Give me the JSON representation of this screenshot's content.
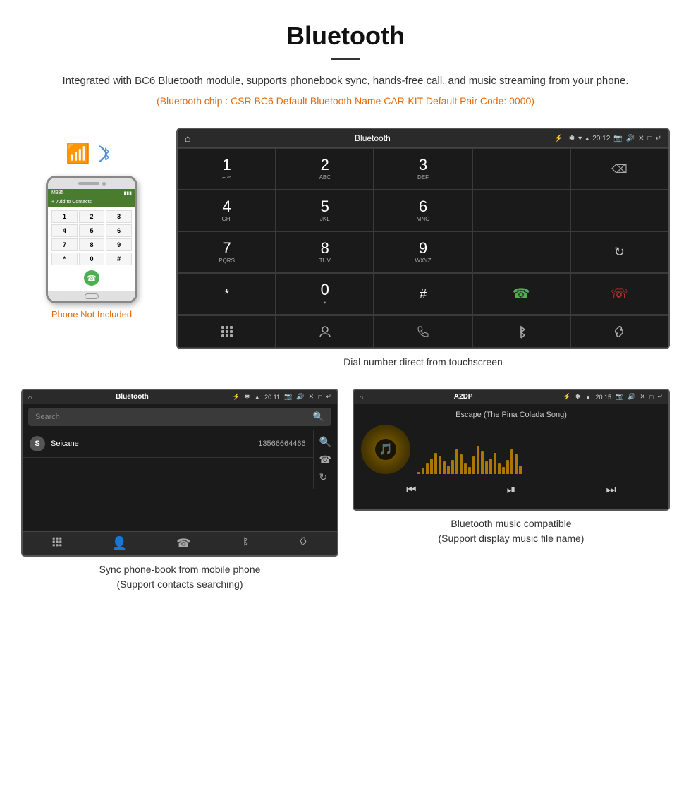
{
  "header": {
    "title": "Bluetooth",
    "description": "Integrated with BC6 Bluetooth module, supports phonebook sync, hands-free call, and music streaming from your phone.",
    "spec_line": "(Bluetooth chip : CSR BC6    Default Bluetooth Name CAR-KIT     Default Pair Code: 0000)"
  },
  "phone_label": "Phone Not Included",
  "dial_screen": {
    "title": "Bluetooth",
    "time": "20:12",
    "caption": "Dial number direct from touchscreen",
    "keys": [
      {
        "num": "1",
        "sub": "⌐"
      },
      {
        "num": "2",
        "sub": "ABC"
      },
      {
        "num": "3",
        "sub": "DEF"
      },
      {
        "num": "",
        "sub": ""
      },
      {
        "num": "⌫",
        "sub": ""
      },
      {
        "num": "4",
        "sub": "GHI"
      },
      {
        "num": "5",
        "sub": "JKL"
      },
      {
        "num": "6",
        "sub": "MNO"
      },
      {
        "num": "",
        "sub": ""
      },
      {
        "num": "",
        "sub": ""
      },
      {
        "num": "7",
        "sub": "PQRS"
      },
      {
        "num": "8",
        "sub": "TUV"
      },
      {
        "num": "9",
        "sub": "WXYZ"
      },
      {
        "num": "",
        "sub": ""
      },
      {
        "num": "↺",
        "sub": ""
      },
      {
        "num": "*",
        "sub": ""
      },
      {
        "num": "0",
        "sub": "+"
      },
      {
        "num": "#",
        "sub": ""
      },
      {
        "num": "📞",
        "sub": ""
      },
      {
        "num": "📞end",
        "sub": ""
      }
    ]
  },
  "phonebook_screen": {
    "title": "Bluetooth",
    "time": "20:11",
    "search_placeholder": "Search",
    "contact": {
      "initial": "S",
      "name": "Seicane",
      "number": "13566664466"
    },
    "caption_line1": "Sync phone-book from mobile phone",
    "caption_line2": "(Support contacts searching)"
  },
  "music_screen": {
    "title": "A2DP",
    "time": "20:15",
    "song_title": "Escape (The Pina Colada Song)",
    "caption_line1": "Bluetooth music compatible",
    "caption_line2": "(Support display music file name)"
  },
  "eq_bars": [
    3,
    8,
    15,
    22,
    30,
    25,
    18,
    12,
    20,
    35,
    28,
    15,
    10,
    25,
    40,
    32,
    18,
    22,
    30,
    15,
    10,
    20,
    35,
    28,
    12
  ]
}
